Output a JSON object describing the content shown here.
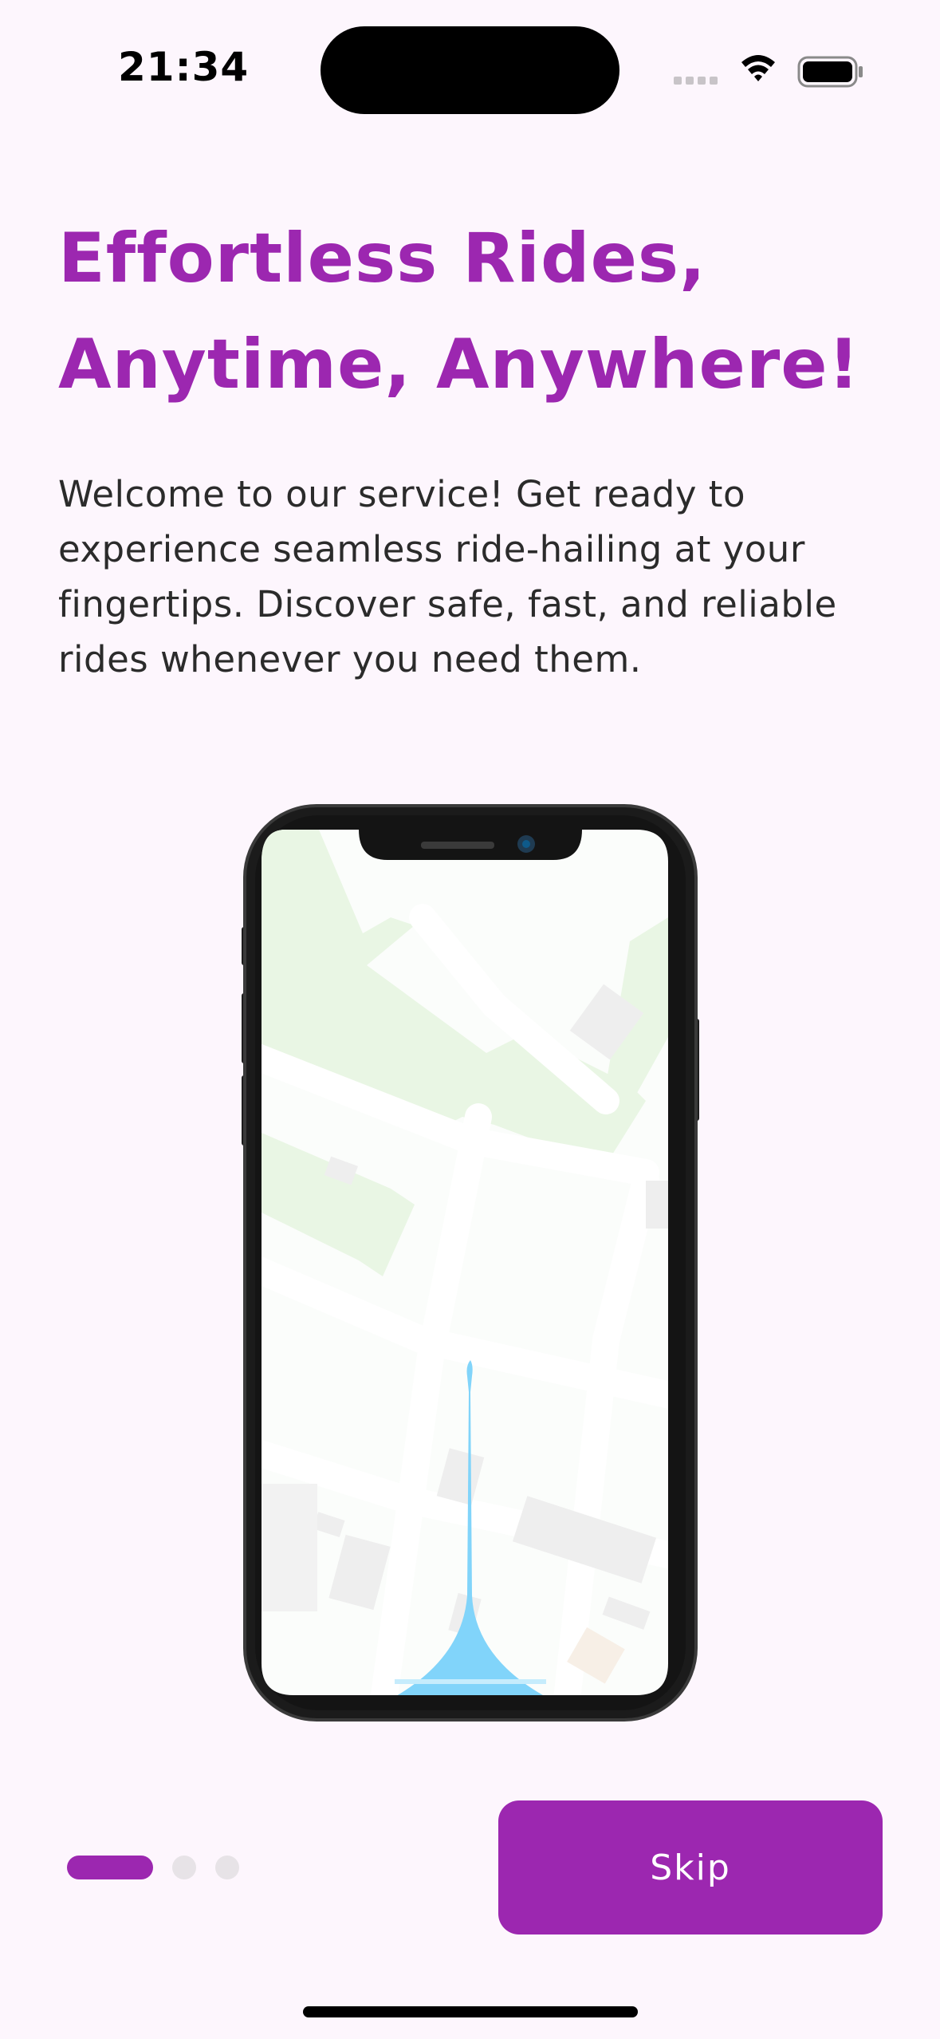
{
  "status_bar": {
    "time": "21:34"
  },
  "onboarding": {
    "title": "Effortless Rides, Anytime, Anywhere!",
    "description": "Welcome to our service! Get ready to experience seamless ride-hailing at your fingertips. Discover safe, fast, and reliable rides whenever you need them.",
    "skip_label": "Skip",
    "pages_total": 3,
    "current_page": 1
  },
  "colors": {
    "accent": "#9c27b0",
    "background": "#fdf6fd",
    "route": "#81d4fa",
    "park": "#e8f5e3"
  },
  "icons": [
    "cellular-signal-icon",
    "wifi-icon",
    "battery-icon"
  ]
}
